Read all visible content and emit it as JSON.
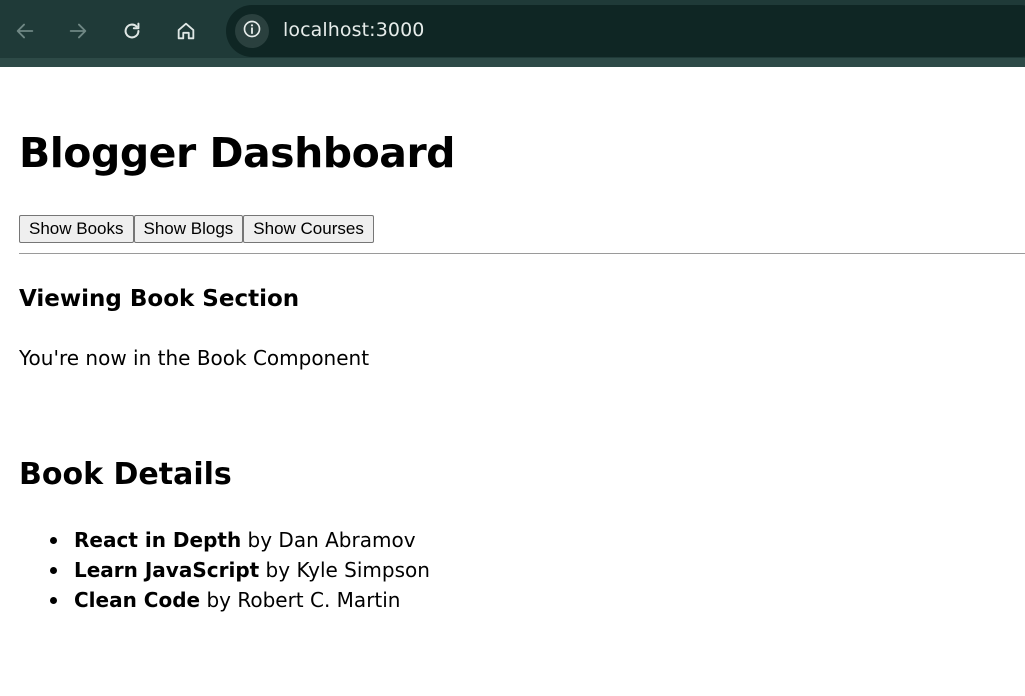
{
  "browser": {
    "url": "localhost:3000",
    "icons": [
      "back-icon",
      "forward-icon",
      "reload-icon",
      "home-icon",
      "info-icon"
    ]
  },
  "page": {
    "title": "Blogger Dashboard",
    "buttons": {
      "books": "Show Books",
      "blogs": "Show Blogs",
      "courses": "Show Courses"
    },
    "section": {
      "heading": "Viewing Book Section",
      "text": "You're now in the Book Component"
    },
    "details": {
      "heading": "Book Details",
      "books": [
        {
          "title": "React in Depth",
          "by": " by Dan Abramov"
        },
        {
          "title": "Learn JavaScript",
          "by": " by Kyle Simpson"
        },
        {
          "title": "Clean Code",
          "by": " by Robert C. Martin"
        }
      ]
    }
  },
  "colors": {
    "browser_bar": "#1f3a38",
    "address_bar": "#0f2624"
  }
}
